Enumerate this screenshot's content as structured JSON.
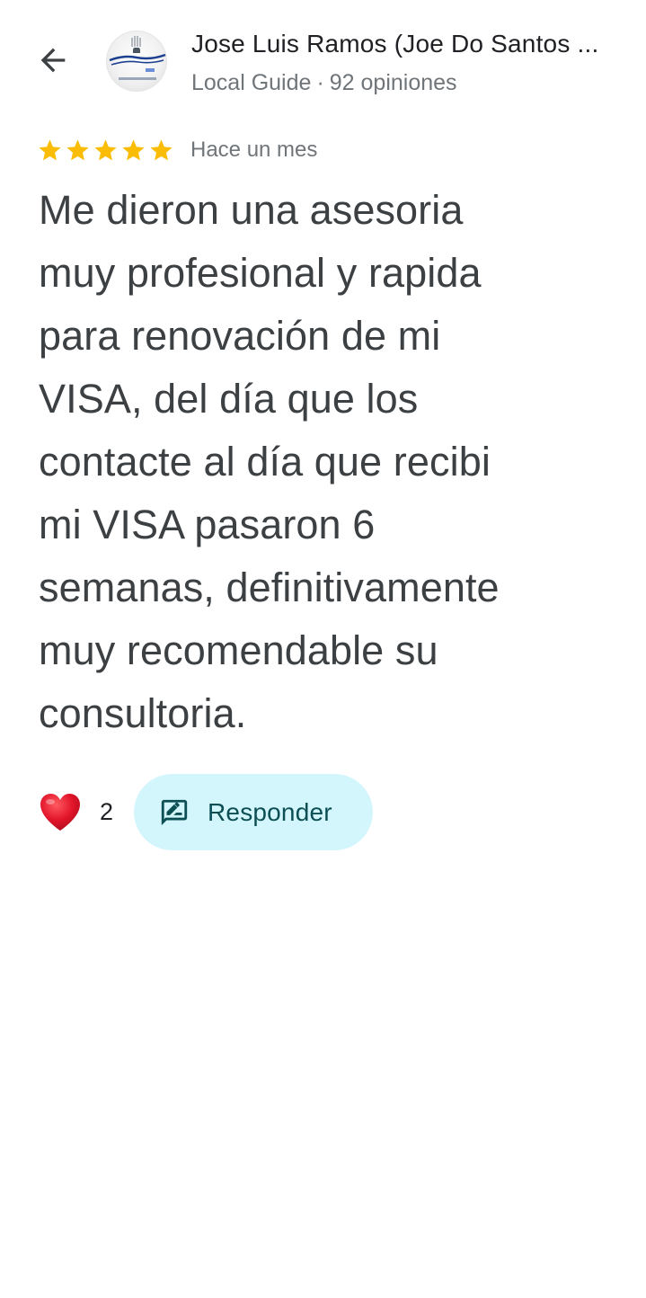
{
  "header": {
    "back_icon": "arrow-left-icon",
    "author_name": "Jose Luis Ramos (Joe Do Santos ...",
    "author_badge": "Local Guide",
    "separator": "·",
    "review_count": "92 opiniones"
  },
  "review": {
    "rating": 5,
    "rating_max": 5,
    "star_color": "#fbbc04",
    "date": "Hace un mes",
    "lines": [
      "Me dieron una asesoria",
      "muy profesional y rapida",
      "para renovación de mi",
      "VISA, del día que los",
      "contacte al día que recibi",
      "mi VISA pasaron 6",
      "semanas, definitivamente",
      "muy recomendable su",
      "consultoria."
    ]
  },
  "actions": {
    "like_icon": "heart-icon",
    "like_count": "2",
    "reply_icon": "reply-icon",
    "reply_label": "Responder",
    "reply_bg": "#d3f6fc",
    "reply_text_color": "#0b4f54"
  }
}
